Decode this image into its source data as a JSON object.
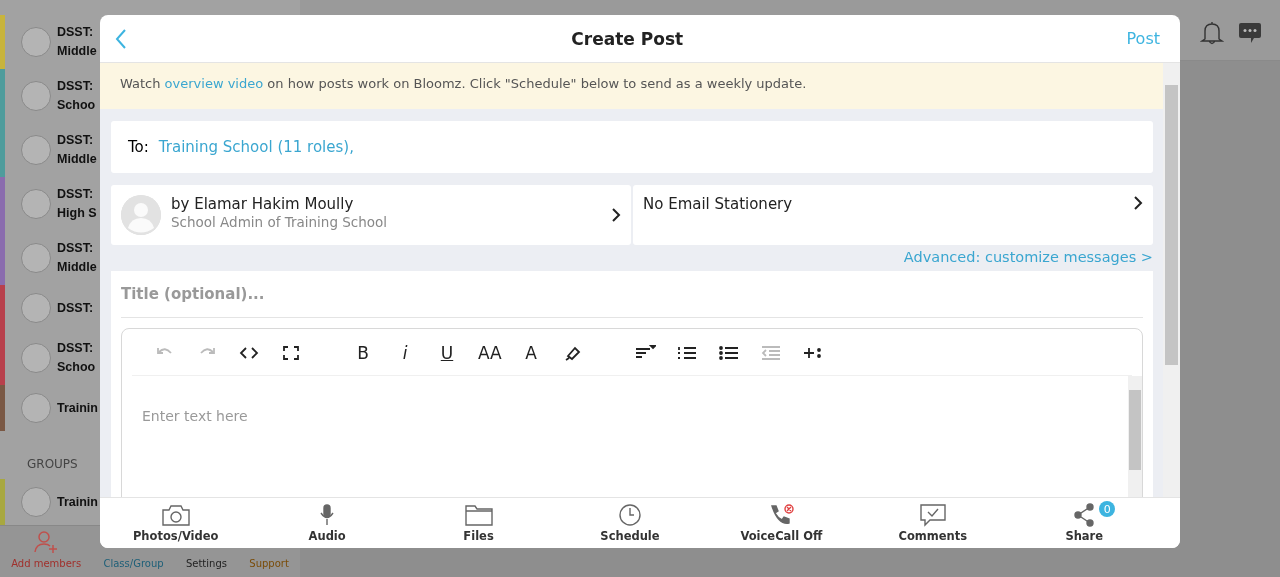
{
  "sidebar": {
    "classes": [
      {
        "color": "#c8b43c",
        "lines": [
          "DSST:",
          "Middle"
        ]
      },
      {
        "color": "#4f9c9c",
        "lines": [
          "DSST:",
          "Schoo"
        ]
      },
      {
        "color": "#4f9c9c",
        "lines": [
          "DSST:",
          "Middle"
        ]
      },
      {
        "color": "#8a6cae",
        "lines": [
          "DSST:",
          "High S"
        ]
      },
      {
        "color": "#8a6cae",
        "lines": [
          "DSST:",
          "Middle"
        ]
      },
      {
        "color": "#b8404c",
        "lines": [
          "DSST:"
        ]
      },
      {
        "color": "#b8404c",
        "lines": [
          "DSST:",
          "Schoo"
        ]
      },
      {
        "color": "#7a5844",
        "lines": [
          "Trainin"
        ]
      }
    ],
    "groups_heading": "GROUPS",
    "groups": [
      {
        "color": "#a8a840",
        "lines": [
          "Trainin"
        ]
      }
    ],
    "bottom_nav": [
      {
        "kind": "add",
        "label": "Add members"
      },
      {
        "kind": "class",
        "label": "Class/Group"
      },
      {
        "kind": "settings",
        "label": "Settings"
      },
      {
        "kind": "support",
        "label": "Support"
      }
    ]
  },
  "modal": {
    "title": "Create Post",
    "post": "Post",
    "notice": {
      "before": "Watch ",
      "link": "overview video",
      "after": " on how posts work on Bloomz. Click \"Schedule\" below to send as a weekly update."
    },
    "to_label": "To:",
    "recipients": "Training School (11 roles),",
    "author": {
      "name": "by Elamar Hakim Moully",
      "role": "School Admin of Training School"
    },
    "stationery": "No Email Stationery",
    "advanced_link": "Advanced: customize messages >",
    "title_placeholder": "Title (optional)...",
    "toolbar": [
      {
        "tools": [
          {
            "kind": "undo",
            "disabled": true
          },
          {
            "kind": "redo",
            "disabled": true
          },
          {
            "kind": "code",
            "disabled": false
          },
          {
            "kind": "fullscreen",
            "disabled": false
          }
        ]
      },
      {
        "tools": [
          {
            "kind": "bold",
            "glyph": "B",
            "disabled": false
          },
          {
            "kind": "italic",
            "glyph": "i",
            "disabled": false
          },
          {
            "kind": "underline",
            "glyph": "U",
            "disabled": false
          },
          {
            "kind": "fontsize",
            "glyph": "AA",
            "disabled": false
          },
          {
            "kind": "fontcolor",
            "glyph": "A",
            "disabled": false
          },
          {
            "kind": "highlight",
            "disabled": false
          }
        ]
      },
      {
        "tools": [
          {
            "kind": "align",
            "disabled": false
          },
          {
            "kind": "ol",
            "disabled": false
          },
          {
            "kind": "ul",
            "disabled": false
          },
          {
            "kind": "outdent",
            "disabled": true
          },
          {
            "kind": "insert",
            "disabled": false
          }
        ]
      }
    ],
    "editor_placeholder": "Enter text here",
    "actions": [
      {
        "kind": "photo",
        "label": "Photos/Video"
      },
      {
        "kind": "audio",
        "label": "Audio"
      },
      {
        "kind": "files",
        "label": "Files"
      },
      {
        "kind": "schedule",
        "label": "Schedule"
      },
      {
        "kind": "voicecall",
        "label": "VoiceCall Off"
      },
      {
        "kind": "comments",
        "label": "Comments"
      },
      {
        "kind": "share",
        "label": "Share",
        "badge": "0"
      }
    ]
  }
}
